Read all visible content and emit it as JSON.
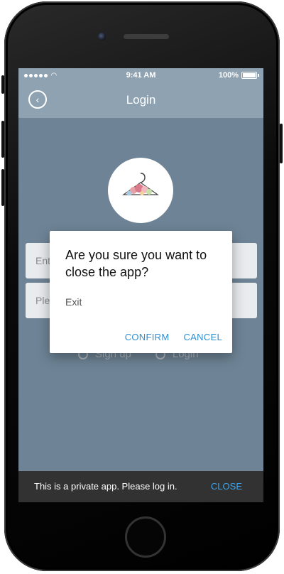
{
  "status_bar": {
    "time": "9:41 AM",
    "battery": "100%"
  },
  "navbar": {
    "title": "Login",
    "back_icon": "chevron-left-icon"
  },
  "form": {
    "email_placeholder": "Enter your email",
    "password_placeholder": "Please enter password",
    "signup_label": "Sign up",
    "login_label": "Login"
  },
  "dialog": {
    "title": "Are you sure you want to close the app?",
    "message": "Exit",
    "confirm_label": "CONFIRM",
    "cancel_label": "CANCEL"
  },
  "snackbar": {
    "message": "This is a private app. Please log in.",
    "action_label": "CLOSE"
  },
  "colors": {
    "accent": "#2b8fd6",
    "snackbar_action": "#3ea6ee",
    "header": "#8fa2b1",
    "background": "#6c8193"
  }
}
